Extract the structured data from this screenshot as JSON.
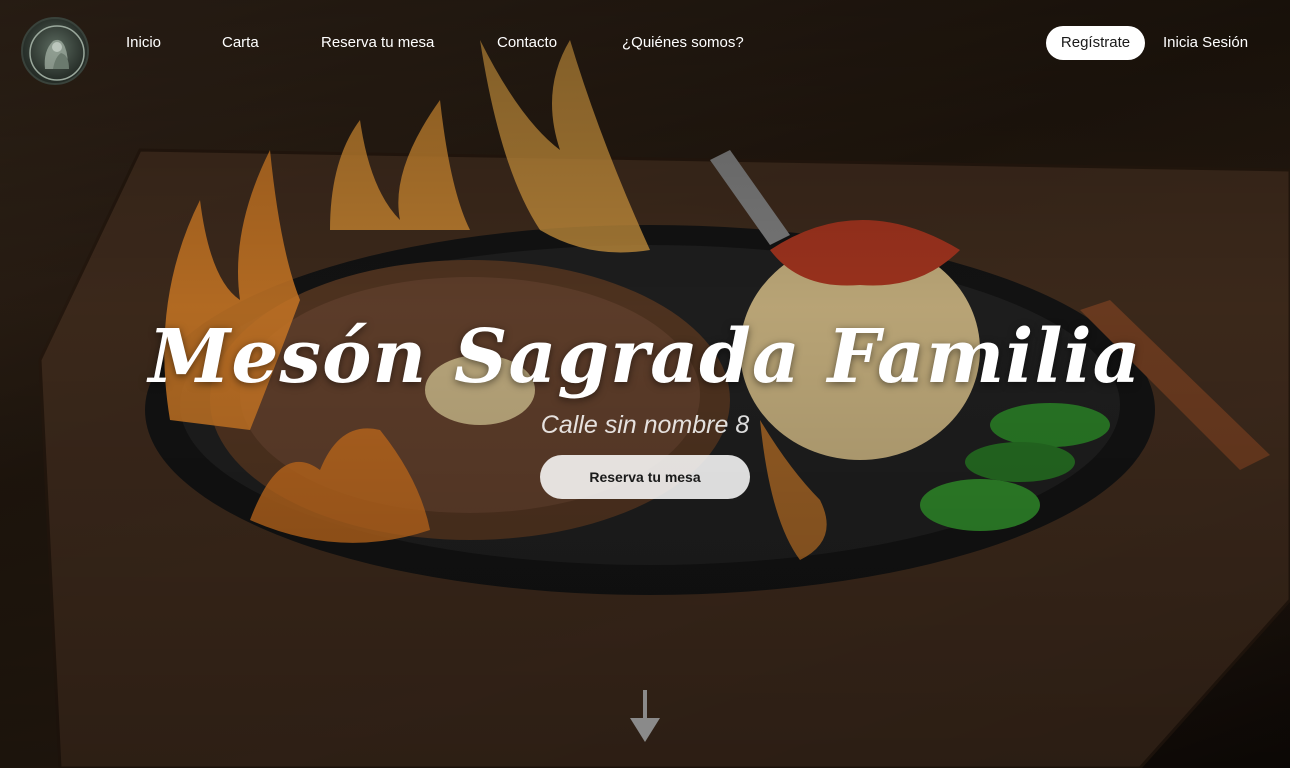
{
  "nav": {
    "links": [
      {
        "label": "Inicio"
      },
      {
        "label": "Carta"
      },
      {
        "label": "Reserva tu mesa"
      },
      {
        "label": "Contacto"
      },
      {
        "label": "¿Quiénes somos?"
      }
    ],
    "register_label": "Regístrate",
    "login_label": "Inicia Sesión"
  },
  "hero": {
    "title": "Mesón Sagrada Familia",
    "address": "Calle sin nombre 8",
    "reserve_label": "Reserva tu mesa"
  },
  "icons": {
    "scroll": "arrow-down-icon",
    "logo": "logo-emblem"
  },
  "colors": {
    "nav_text": "#ffffff",
    "register_bg": "#ffffff",
    "reserve_bg": "#ffffffd9",
    "overlay": "#000000"
  }
}
